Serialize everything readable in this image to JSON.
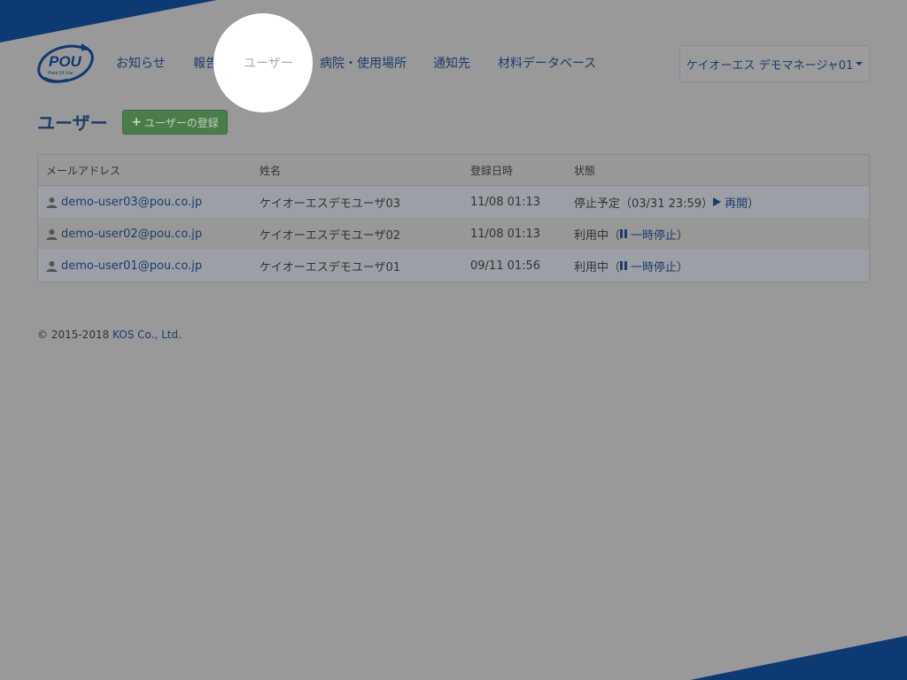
{
  "brand": {
    "logo_text": "POU",
    "logo_tagline": "Point Of Use",
    "navy": "#0d3a73",
    "link_color": "#1d3c6b",
    "success": "#4a7d4a"
  },
  "nav": {
    "items": [
      {
        "label": "お知らせ"
      },
      {
        "label": "報告"
      },
      {
        "label": "ユーザー"
      },
      {
        "label": "病院・使用場所"
      },
      {
        "label": "通知先"
      },
      {
        "label": "材料データベース"
      }
    ],
    "active": "ユーザー"
  },
  "user_menu": {
    "label": "ケイオーエス デモマネージャ01"
  },
  "page": {
    "title": "ユーザー",
    "add_button": "ユーザーの登録"
  },
  "table": {
    "headers": {
      "email": "メールアドレス",
      "name": "姓名",
      "registered": "登録日時",
      "status": "状態"
    },
    "rows": [
      {
        "email": "demo-user03@pou.co.jp",
        "name": "ケイオーエスデモユーザ03",
        "registered": "11/08 01:13",
        "status_prefix": "停止予定（03/31 23:59）",
        "action": "再開",
        "action_icon": "play-icon",
        "close": "）"
      },
      {
        "email": "demo-user02@pou.co.jp",
        "name": "ケイオーエスデモユーザ02",
        "registered": "11/08 01:13",
        "status_prefix": "利用中（",
        "action": "一時停止",
        "action_icon": "pause-icon",
        "close": "）"
      },
      {
        "email": "demo-user01@pou.co.jp",
        "name": "ケイオーエスデモユーザ01",
        "registered": "09/11 01:56",
        "status_prefix": "利用中（",
        "action": "一時停止",
        "action_icon": "pause-icon",
        "close": "）"
      }
    ]
  },
  "footer": {
    "copyright": "© 2015-2018 ",
    "company": "KOS Co., Ltd."
  }
}
